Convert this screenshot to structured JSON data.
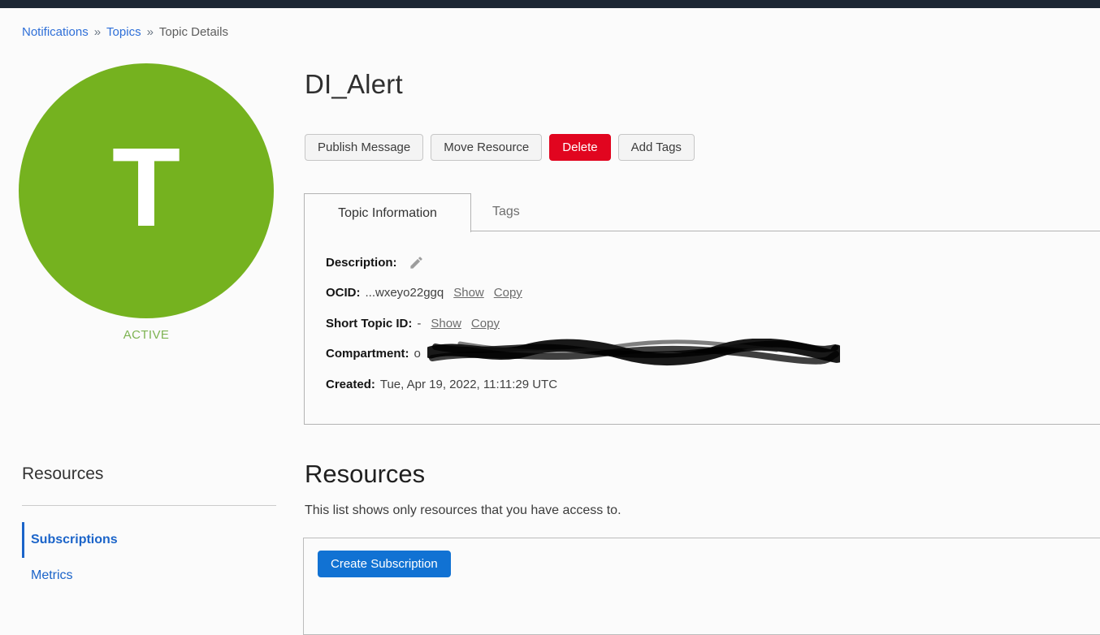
{
  "breadcrumb": {
    "separator": "»",
    "items": [
      {
        "label": "Notifications"
      },
      {
        "label": "Topics"
      },
      {
        "label": "Topic Details"
      }
    ]
  },
  "avatar": {
    "letter": "T",
    "status": "ACTIVE"
  },
  "header": {
    "title": "DI_Alert"
  },
  "actions": {
    "publish_label": "Publish Message",
    "move_label": "Move Resource",
    "delete_label": "Delete",
    "add_tags_label": "Add Tags"
  },
  "tabs": [
    {
      "label": "Topic Information",
      "active": true
    },
    {
      "label": "Tags",
      "active": false
    }
  ],
  "topic_info": {
    "description": {
      "label": "Description:",
      "value": ""
    },
    "ocid": {
      "label": "OCID:",
      "value": "...wxeyo22ggq",
      "show_label": "Show",
      "copy_label": "Copy"
    },
    "short_topic_id": {
      "label": "Short Topic ID:",
      "value": "-",
      "show_label": "Show",
      "copy_label": "Copy"
    },
    "compartment": {
      "label": "Compartment:",
      "visible_fragment": "o",
      "redacted": true
    },
    "created": {
      "label": "Created:",
      "value": "Tue, Apr 19, 2022, 11:11:29 UTC"
    }
  },
  "sidebar": {
    "heading": "Resources",
    "items": [
      {
        "label": "Subscriptions",
        "active": true
      },
      {
        "label": "Metrics",
        "active": false
      }
    ]
  },
  "resources_section": {
    "heading": "Resources",
    "description": "This list shows only resources that you have access to.",
    "create_button_label": "Create Subscription"
  },
  "colors": {
    "topbar": "#1d2734",
    "link_blue": "#2e6fd8",
    "sidebar_blue": "#1b64c9",
    "active_green": "#75b21f",
    "status_text_green": "#7db351",
    "delete_red": "#e1051f",
    "primary_blue": "#1172d3"
  }
}
